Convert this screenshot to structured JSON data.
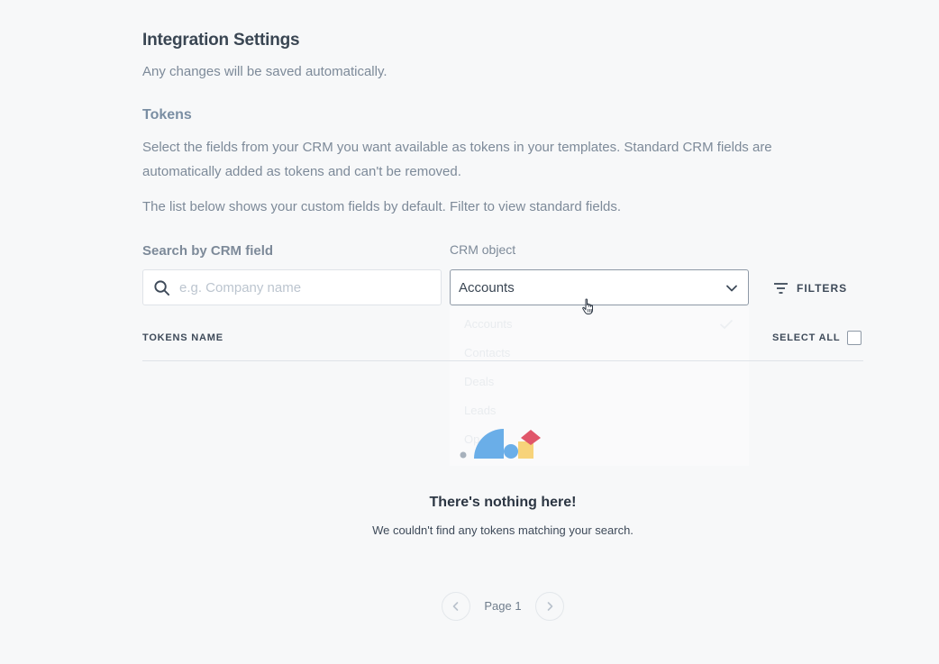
{
  "header": {
    "title": "Integration Settings",
    "subtitle": "Any changes will be saved automatically."
  },
  "tokens": {
    "section_title": "Tokens",
    "description": "Select the fields from your CRM you want available as tokens in your templates. Standard CRM fields are automatically added as tokens and can't be removed.",
    "note": "The list below shows your custom fields by default. Filter to view standard fields."
  },
  "search": {
    "label": "Search by CRM field",
    "placeholder": "e.g. Company name",
    "value": ""
  },
  "crm_object": {
    "label": "CRM object",
    "selected": "Accounts",
    "options": [
      "Accounts",
      "Contacts",
      "Deals",
      "Leads",
      "Op"
    ]
  },
  "filters": {
    "label": "FILTERS"
  },
  "table": {
    "column_header": "TOKENS NAME",
    "select_all_label": "SELECT ALL"
  },
  "empty_state": {
    "title": "There's nothing here!",
    "message": "We couldn't find any tokens matching your search."
  },
  "pagination": {
    "label": "Page 1"
  },
  "colors": {
    "illustration_blue": "#6aaee8",
    "illustration_yellow": "#f7d37a",
    "illustration_red": "#e0566a",
    "illustration_gray": "#a7b1bc"
  },
  "icons": [
    "search-icon",
    "chevron-down-icon",
    "filter-icon",
    "check-icon",
    "chevron-left-icon",
    "chevron-right-icon",
    "hand-cursor-icon"
  ]
}
